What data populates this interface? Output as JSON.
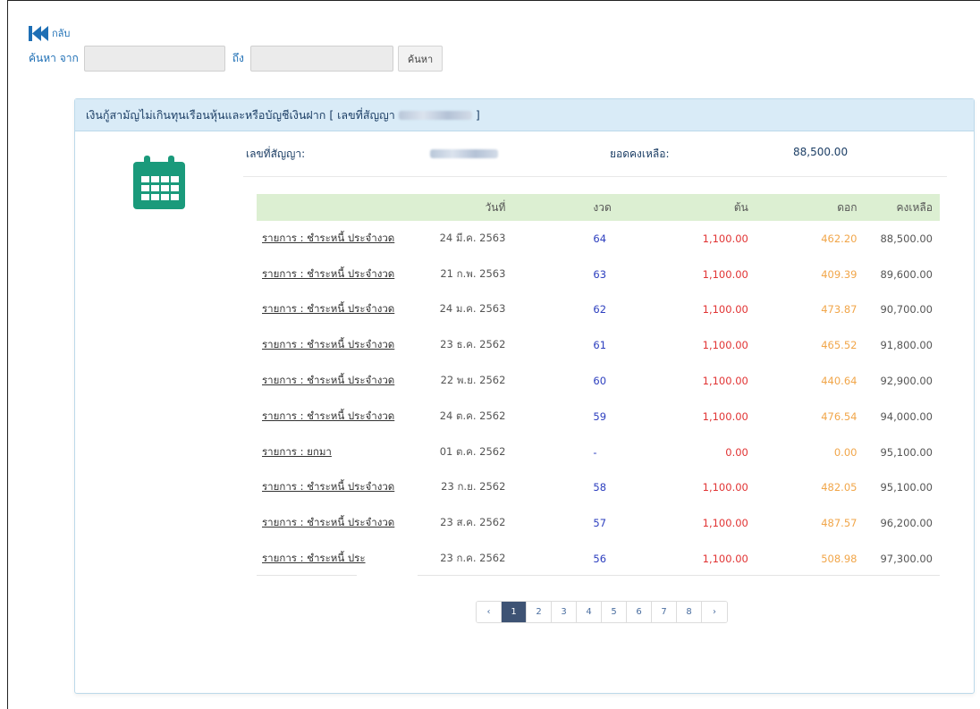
{
  "nav": {
    "back_label": "กลับ"
  },
  "search": {
    "from_label": "ค้นหา จาก",
    "to_label": "ถึง",
    "from_value": "",
    "to_value": "",
    "button_label": "ค้นหา"
  },
  "panel": {
    "title_prefix": "เงินกู้สามัญไม่เกินทุนเรือนหุ้นและหรือบัญชีเงินฝาก [ เลขที่สัญญา",
    "title_suffix": "]",
    "contract_label": "เลขที่สัญญา:",
    "balance_label": "ยอดคงเหลือ:",
    "balance_value": "88,500.00"
  },
  "table": {
    "headers": [
      "",
      "วันที่",
      "งวด",
      "ต้น",
      "ดอก",
      "คงเหลือ"
    ],
    "rows": [
      {
        "item": "รายการ : ชำระหนี้ ประจำงวด",
        "date": "24 มี.ค. 2563",
        "period": "64",
        "principal": "1,100.00",
        "interest": "462.20",
        "balance": "88,500.00"
      },
      {
        "item": "รายการ : ชำระหนี้ ประจำงวด",
        "date": "21 ก.พ. 2563",
        "period": "63",
        "principal": "1,100.00",
        "interest": "409.39",
        "balance": "89,600.00"
      },
      {
        "item": "รายการ : ชำระหนี้ ประจำงวด",
        "date": "24 ม.ค. 2563",
        "period": "62",
        "principal": "1,100.00",
        "interest": "473.87",
        "balance": "90,700.00"
      },
      {
        "item": "รายการ : ชำระหนี้ ประจำงวด",
        "date": "23 ธ.ค. 2562",
        "period": "61",
        "principal": "1,100.00",
        "interest": "465.52",
        "balance": "91,800.00"
      },
      {
        "item": "รายการ : ชำระหนี้ ประจำงวด",
        "date": "22 พ.ย. 2562",
        "period": "60",
        "principal": "1,100.00",
        "interest": "440.64",
        "balance": "92,900.00"
      },
      {
        "item": "รายการ : ชำระหนี้ ประจำงวด",
        "date": "24 ต.ค. 2562",
        "period": "59",
        "principal": "1,100.00",
        "interest": "476.54",
        "balance": "94,000.00"
      },
      {
        "item": "รายการ : ยกมา",
        "date": "01 ต.ค. 2562",
        "period": "-",
        "principal": "0.00",
        "interest": "0.00",
        "balance": "95,100.00"
      },
      {
        "item": "รายการ : ชำระหนี้ ประจำงวด",
        "date": "23 ก.ย. 2562",
        "period": "58",
        "principal": "1,100.00",
        "interest": "482.05",
        "balance": "95,100.00"
      },
      {
        "item": "รายการ : ชำระหนี้ ประจำงวด",
        "date": "23 ส.ค. 2562",
        "period": "57",
        "principal": "1,100.00",
        "interest": "487.57",
        "balance": "96,200.00"
      },
      {
        "item": "รายการ : ชำระหนี้ ประ",
        "date": "23 ก.ค. 2562",
        "period": "56",
        "principal": "1,100.00",
        "interest": "508.98",
        "balance": "97,300.00"
      }
    ]
  },
  "pagination": {
    "prev": "‹",
    "pages": [
      "1",
      "2",
      "3",
      "4",
      "5",
      "6",
      "7",
      "8"
    ],
    "next": "›",
    "current": "1"
  },
  "colors": {
    "accent": "#1e6fb5",
    "header_bg": "#d9ebf7",
    "table_header_bg": "#dcefd2",
    "calendar_icon": "#1a9a7b",
    "period_text": "#2d3fbf",
    "principal_text": "#e13434",
    "interest_text": "#f1a64a",
    "pager_active": "#3e5374"
  },
  "icons": {
    "back": "skip-back-icon",
    "calendar": "calendar-icon"
  }
}
